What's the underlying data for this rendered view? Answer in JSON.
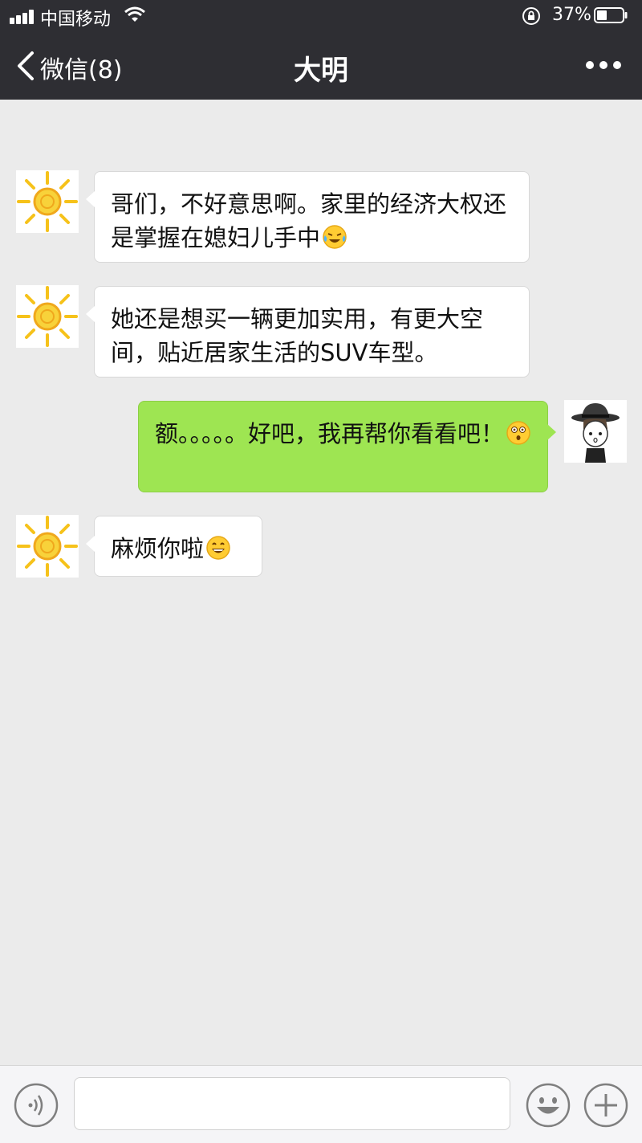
{
  "status_bar": {
    "carrier": "中国移动",
    "battery_percent": "37%",
    "signal_icon": "signal-bars-icon",
    "wifi_icon": "wifi-icon",
    "lock_icon": "rotation-lock-icon",
    "battery_icon": "battery-icon"
  },
  "nav": {
    "back_label": "微信(8)",
    "title": "大明",
    "back_icon": "chevron-left-icon",
    "more_icon": "more-dots-icon"
  },
  "messages": [
    {
      "direction": "in",
      "avatar": "sun-avatar",
      "text": "哥们，不好意思啊。家里的经济大权还是掌握在媳妇儿手中",
      "emoji": "crying-laughing-emoji"
    },
    {
      "direction": "in",
      "avatar": "sun-avatar",
      "text": "她还是想买一辆更加实用，有更大空间，贴近居家生活的SUV车型。",
      "emoji": ""
    },
    {
      "direction": "out",
      "avatar": "cartoon-boy-avatar",
      "text": "额。。。。。好吧，我再帮你看看吧！",
      "emoji": "shocked-emoji"
    },
    {
      "direction": "in",
      "avatar": "sun-avatar",
      "text": "麻烦你啦",
      "emoji": "grinning-emoji"
    }
  ],
  "input_bar": {
    "placeholder": "",
    "voice_icon": "voice-icon",
    "emoji_icon": "smiley-icon",
    "plus_icon": "plus-icon"
  },
  "colors": {
    "header_bg": "#2e2e33",
    "chat_bg": "#ebebeb",
    "incoming_bubble": "#ffffff",
    "outgoing_bubble": "#9ee552"
  }
}
